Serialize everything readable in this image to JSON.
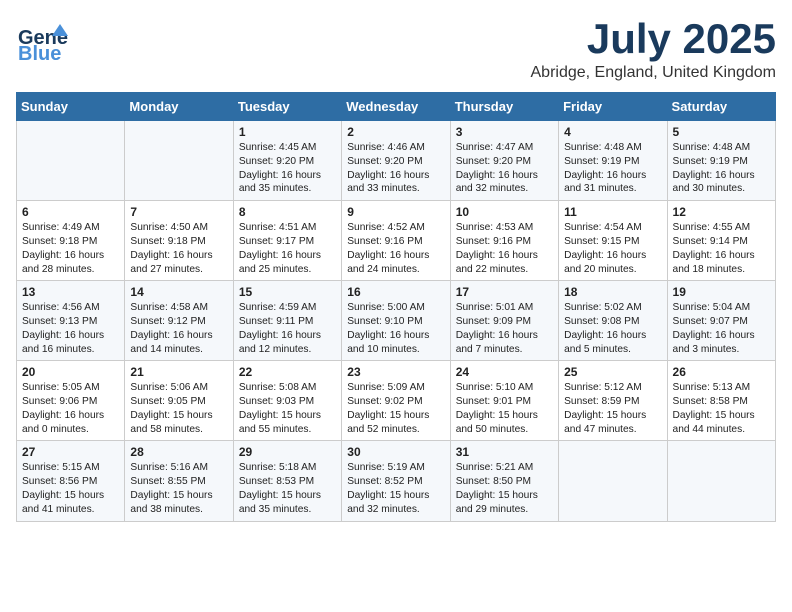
{
  "header": {
    "logo_line1": "General",
    "logo_line2": "Blue",
    "month_title": "July 2025",
    "location": "Abridge, England, United Kingdom"
  },
  "days_of_week": [
    "Sunday",
    "Monday",
    "Tuesday",
    "Wednesday",
    "Thursday",
    "Friday",
    "Saturday"
  ],
  "weeks": [
    [
      {
        "day": "",
        "content": ""
      },
      {
        "day": "",
        "content": ""
      },
      {
        "day": "1",
        "content": "Sunrise: 4:45 AM\nSunset: 9:20 PM\nDaylight: 16 hours\nand 35 minutes."
      },
      {
        "day": "2",
        "content": "Sunrise: 4:46 AM\nSunset: 9:20 PM\nDaylight: 16 hours\nand 33 minutes."
      },
      {
        "day": "3",
        "content": "Sunrise: 4:47 AM\nSunset: 9:20 PM\nDaylight: 16 hours\nand 32 minutes."
      },
      {
        "day": "4",
        "content": "Sunrise: 4:48 AM\nSunset: 9:19 PM\nDaylight: 16 hours\nand 31 minutes."
      },
      {
        "day": "5",
        "content": "Sunrise: 4:48 AM\nSunset: 9:19 PM\nDaylight: 16 hours\nand 30 minutes."
      }
    ],
    [
      {
        "day": "6",
        "content": "Sunrise: 4:49 AM\nSunset: 9:18 PM\nDaylight: 16 hours\nand 28 minutes."
      },
      {
        "day": "7",
        "content": "Sunrise: 4:50 AM\nSunset: 9:18 PM\nDaylight: 16 hours\nand 27 minutes."
      },
      {
        "day": "8",
        "content": "Sunrise: 4:51 AM\nSunset: 9:17 PM\nDaylight: 16 hours\nand 25 minutes."
      },
      {
        "day": "9",
        "content": "Sunrise: 4:52 AM\nSunset: 9:16 PM\nDaylight: 16 hours\nand 24 minutes."
      },
      {
        "day": "10",
        "content": "Sunrise: 4:53 AM\nSunset: 9:16 PM\nDaylight: 16 hours\nand 22 minutes."
      },
      {
        "day": "11",
        "content": "Sunrise: 4:54 AM\nSunset: 9:15 PM\nDaylight: 16 hours\nand 20 minutes."
      },
      {
        "day": "12",
        "content": "Sunrise: 4:55 AM\nSunset: 9:14 PM\nDaylight: 16 hours\nand 18 minutes."
      }
    ],
    [
      {
        "day": "13",
        "content": "Sunrise: 4:56 AM\nSunset: 9:13 PM\nDaylight: 16 hours\nand 16 minutes."
      },
      {
        "day": "14",
        "content": "Sunrise: 4:58 AM\nSunset: 9:12 PM\nDaylight: 16 hours\nand 14 minutes."
      },
      {
        "day": "15",
        "content": "Sunrise: 4:59 AM\nSunset: 9:11 PM\nDaylight: 16 hours\nand 12 minutes."
      },
      {
        "day": "16",
        "content": "Sunrise: 5:00 AM\nSunset: 9:10 PM\nDaylight: 16 hours\nand 10 minutes."
      },
      {
        "day": "17",
        "content": "Sunrise: 5:01 AM\nSunset: 9:09 PM\nDaylight: 16 hours\nand 7 minutes."
      },
      {
        "day": "18",
        "content": "Sunrise: 5:02 AM\nSunset: 9:08 PM\nDaylight: 16 hours\nand 5 minutes."
      },
      {
        "day": "19",
        "content": "Sunrise: 5:04 AM\nSunset: 9:07 PM\nDaylight: 16 hours\nand 3 minutes."
      }
    ],
    [
      {
        "day": "20",
        "content": "Sunrise: 5:05 AM\nSunset: 9:06 PM\nDaylight: 16 hours\nand 0 minutes."
      },
      {
        "day": "21",
        "content": "Sunrise: 5:06 AM\nSunset: 9:05 PM\nDaylight: 15 hours\nand 58 minutes."
      },
      {
        "day": "22",
        "content": "Sunrise: 5:08 AM\nSunset: 9:03 PM\nDaylight: 15 hours\nand 55 minutes."
      },
      {
        "day": "23",
        "content": "Sunrise: 5:09 AM\nSunset: 9:02 PM\nDaylight: 15 hours\nand 52 minutes."
      },
      {
        "day": "24",
        "content": "Sunrise: 5:10 AM\nSunset: 9:01 PM\nDaylight: 15 hours\nand 50 minutes."
      },
      {
        "day": "25",
        "content": "Sunrise: 5:12 AM\nSunset: 8:59 PM\nDaylight: 15 hours\nand 47 minutes."
      },
      {
        "day": "26",
        "content": "Sunrise: 5:13 AM\nSunset: 8:58 PM\nDaylight: 15 hours\nand 44 minutes."
      }
    ],
    [
      {
        "day": "27",
        "content": "Sunrise: 5:15 AM\nSunset: 8:56 PM\nDaylight: 15 hours\nand 41 minutes."
      },
      {
        "day": "28",
        "content": "Sunrise: 5:16 AM\nSunset: 8:55 PM\nDaylight: 15 hours\nand 38 minutes."
      },
      {
        "day": "29",
        "content": "Sunrise: 5:18 AM\nSunset: 8:53 PM\nDaylight: 15 hours\nand 35 minutes."
      },
      {
        "day": "30",
        "content": "Sunrise: 5:19 AM\nSunset: 8:52 PM\nDaylight: 15 hours\nand 32 minutes."
      },
      {
        "day": "31",
        "content": "Sunrise: 5:21 AM\nSunset: 8:50 PM\nDaylight: 15 hours\nand 29 minutes."
      },
      {
        "day": "",
        "content": ""
      },
      {
        "day": "",
        "content": ""
      }
    ]
  ]
}
